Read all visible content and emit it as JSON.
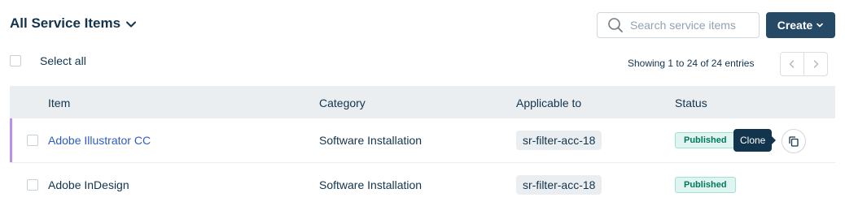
{
  "header": {
    "title": "All Service Items",
    "search_placeholder": "Search service items",
    "create_label": "Create"
  },
  "toolbar": {
    "select_all_label": "Select all",
    "entries_text": "Showing 1 to 24 of 24 entries"
  },
  "table": {
    "columns": [
      "Item",
      "Category",
      "Applicable to",
      "Status"
    ],
    "rows": [
      {
        "item": "Adobe Illustrator CC",
        "category": "Software Installation",
        "applicable": "sr-filter-acc-18",
        "status": "Published",
        "tooltip": "Clone"
      },
      {
        "item": "Adobe InDesign",
        "category": "Software Installation",
        "applicable": "sr-filter-acc-18",
        "status": "Published"
      }
    ]
  },
  "colors": {
    "primary": "#264966",
    "link": "#2c5cc5",
    "active_row_accent": "#b98ef0",
    "status_published": "#00795b"
  },
  "icons": [
    "chevron-down-icon",
    "search-icon",
    "chevron-left-icon",
    "chevron-right-icon",
    "clone-icon"
  ]
}
